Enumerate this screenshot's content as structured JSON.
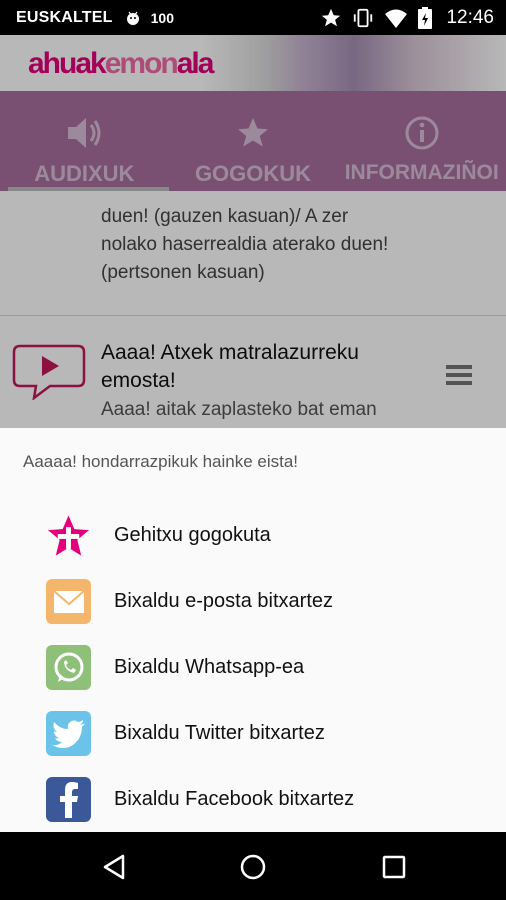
{
  "statusbar": {
    "carrier": "EUSKALTEL",
    "battery_percent": "100",
    "time": "12:46"
  },
  "header": {
    "logo_part1": "ahuak",
    "logo_part2": "emon",
    "logo_part3": "ala"
  },
  "tabs": [
    {
      "label": "AUDIXUK",
      "icon": "speaker-icon",
      "active": true
    },
    {
      "label": "GOGOKUK",
      "icon": "star-icon",
      "active": false
    },
    {
      "label": "INFORMAZIÑOI",
      "icon": "info-icon",
      "active": false
    }
  ],
  "list": {
    "row1_text": "duen! (gauzen kasuan)/ A zer nolako haserrealdia aterako duen! (pertsonen kasuan)",
    "row2_title": "Aaaa! Atxek matralazurreku emosta!",
    "row2_subtitle": "Aaaa! aitak zaplasteko bat eman dit!"
  },
  "sheet": {
    "title": "Aaaaa! hondarrazpikuk hainke eista!",
    "options": [
      {
        "label": "Gehitxu gogokuta",
        "icon": "favorite-star-icon",
        "color": "#e4007c"
      },
      {
        "label": "Bixaldu e-posta bitxartez",
        "icon": "email-icon",
        "color": "#f4b66a"
      },
      {
        "label": "Bixaldu Whatsapp-ea",
        "icon": "whatsapp-icon",
        "color": "#8fc07a"
      },
      {
        "label": "Bixaldu Twitter bitxartez",
        "icon": "twitter-icon",
        "color": "#6cc3ea"
      },
      {
        "label": "Bixaldu Facebook bitxartez",
        "icon": "facebook-icon",
        "color": "#3b5998"
      }
    ]
  },
  "colors": {
    "brand_pink": "#e4007c",
    "tab_bar": "#a8709f"
  }
}
